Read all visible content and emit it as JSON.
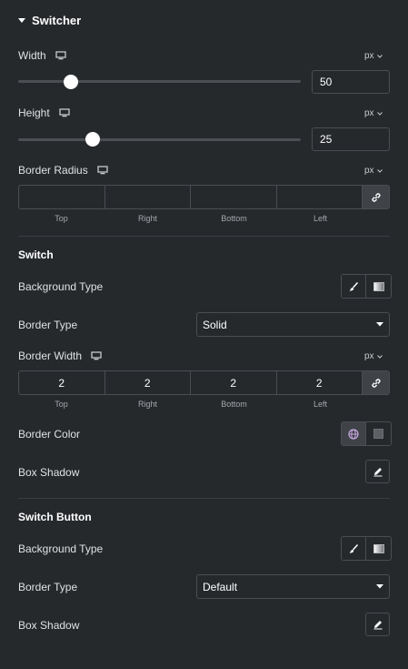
{
  "section": {
    "title": "Switcher"
  },
  "width": {
    "label": "Width",
    "unit": "px",
    "value": "50",
    "slider_fraction": 0.17
  },
  "height": {
    "label": "Height",
    "unit": "px",
    "value": "25",
    "slider_fraction": 0.25
  },
  "border_radius": {
    "label": "Border Radius",
    "unit": "px",
    "values": [
      "",
      "",
      "",
      ""
    ],
    "sides": [
      "Top",
      "Right",
      "Bottom",
      "Left"
    ]
  },
  "switch": {
    "heading": "Switch",
    "background_type_label": "Background Type",
    "border_type_label": "Border Type",
    "border_type_value": "Solid",
    "border_width": {
      "label": "Border Width",
      "unit": "px",
      "values": [
        "2",
        "2",
        "2",
        "2"
      ],
      "sides": [
        "Top",
        "Right",
        "Bottom",
        "Left"
      ]
    },
    "border_color_label": "Border Color",
    "box_shadow_label": "Box Shadow"
  },
  "switch_button": {
    "heading": "Switch Button",
    "background_type_label": "Background Type",
    "border_type_label": "Border Type",
    "border_type_value": "Default",
    "box_shadow_label": "Box Shadow"
  },
  "colors": {
    "background": "#26292c",
    "border": "#4a4d51",
    "active_button": "#3f4348",
    "globe_accent": "#c9a7e0"
  }
}
